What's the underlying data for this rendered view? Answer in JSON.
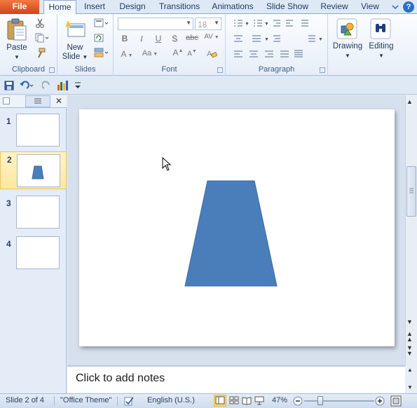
{
  "tabs": {
    "file": "File",
    "home": "Home",
    "insert": "Insert",
    "design": "Design",
    "transitions": "Transitions",
    "animations": "Animations",
    "slideshow": "Slide Show",
    "review": "Review",
    "view": "View"
  },
  "ribbon": {
    "clipboard": {
      "paste": "Paste",
      "label": "Clipboard"
    },
    "slides": {
      "new_slide_1": "New",
      "new_slide_2": "Slide",
      "label": "Slides"
    },
    "font": {
      "font_name": "",
      "font_size": "18",
      "bold": "B",
      "italic": "I",
      "underline": "U",
      "shadow": "S",
      "strike": "abc",
      "spacing": "AV",
      "grow": "A",
      "shrink": "A",
      "case": "Aa",
      "color": "A",
      "label": "Font"
    },
    "paragraph": {
      "label": "Paragraph"
    },
    "drawing": {
      "label": "Drawing"
    },
    "editing": {
      "label": "Editing"
    }
  },
  "slides_panel": {
    "items": [
      {
        "num": "1"
      },
      {
        "num": "2"
      },
      {
        "num": "3"
      },
      {
        "num": "4"
      }
    ]
  },
  "notes": {
    "placeholder": "Click to add notes"
  },
  "status": {
    "slide_info": "Slide 2 of 4",
    "theme": "\"Office Theme\"",
    "language": "English (U.S.)",
    "zoom": "47%"
  },
  "colors": {
    "shape_fill": "#4a7ebb",
    "shape_stroke": "#3a6aa5",
    "file_tab": "#e2531b"
  }
}
